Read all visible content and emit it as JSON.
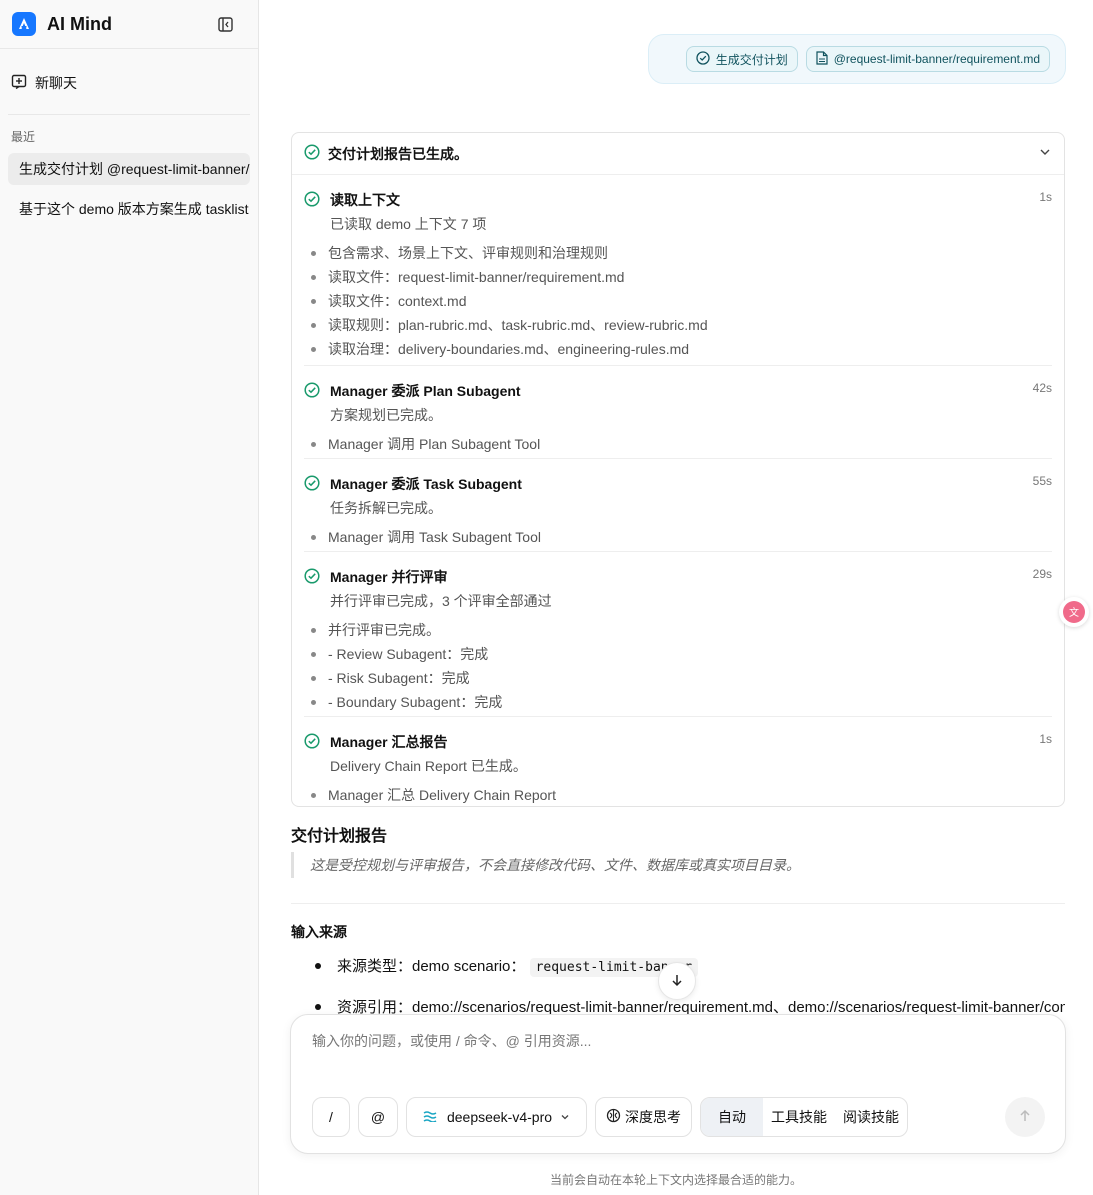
{
  "sidebar": {
    "brand": "AI Mind",
    "new_chat": "新聊天",
    "section_label": "最近",
    "items": [
      {
        "label": "生成交付计划 @request-limit-banner/requirement.md"
      },
      {
        "label": "基于这个 demo 版本方案生成 tasklist"
      }
    ]
  },
  "user_message": {
    "chips": [
      {
        "label": "生成交付计划",
        "icon": "check-circle-icon"
      },
      {
        "label": "@request-limit-banner/requirement.md",
        "icon": "file-icon"
      }
    ]
  },
  "progress": {
    "header": "交付计划报告已生成。",
    "steps": [
      {
        "title": "读取上下文",
        "time": "1s",
        "subtitle": "已读取 demo 上下文 7 项",
        "bullets": [
          "包含需求、场景上下文、评审规则和治理规则",
          "读取文件：request-limit-banner/requirement.md",
          "读取文件：context.md",
          "读取规则：plan-rubric.md、task-rubric.md、review-rubric.md",
          "读取治理：delivery-boundaries.md、engineering-rules.md"
        ]
      },
      {
        "title": "Manager 委派 Plan Subagent",
        "time": "42s",
        "subtitle": "方案规划已完成。",
        "bullets": [
          "Manager 调用 Plan Subagent Tool"
        ]
      },
      {
        "title": "Manager 委派 Task Subagent",
        "time": "55s",
        "subtitle": "任务拆解已完成。",
        "bullets": [
          "Manager 调用 Task Subagent Tool"
        ]
      },
      {
        "title": "Manager 并行评审",
        "time": "29s",
        "subtitle": "并行评审已完成，3 个评审全部通过",
        "bullets": [
          "并行评审已完成。",
          "- Review Subagent：完成",
          "- Risk Subagent：完成",
          "- Boundary Subagent：完成"
        ]
      },
      {
        "title": "Manager 汇总报告",
        "time": "1s",
        "subtitle": "Delivery Chain Report 已生成。",
        "bullets": [
          "Manager 汇总 Delivery Chain Report"
        ]
      }
    ]
  },
  "report": {
    "title": "交付计划报告",
    "quote": "这是受控规划与评审报告，不会直接修改代码、文件、数据库或真实项目目录。",
    "input_source_heading": "输入来源",
    "source_type_label": "来源类型：demo scenario：",
    "source_type_code": "request-limit-banner",
    "resource_ref": "资源引用：demo://scenarios/request-limit-banner/requirement.md、demo://scenarios/request-limit-banner/context.md"
  },
  "composer": {
    "placeholder": "输入你的问题，或使用 / 命令、@ 引用资源...",
    "slash": "/",
    "at": "@",
    "model": "deepseek-v4-pro",
    "deep_think": "深度思考",
    "modes": [
      "自动",
      "工具技能",
      "阅读技能"
    ],
    "active_mode": "自动"
  },
  "footer_note": "当前会自动在本轮上下文内选择最合适的能力。",
  "colors": {
    "accent": "#1677ff",
    "success": "#1a9a6c",
    "chip_text": "#11535e"
  }
}
